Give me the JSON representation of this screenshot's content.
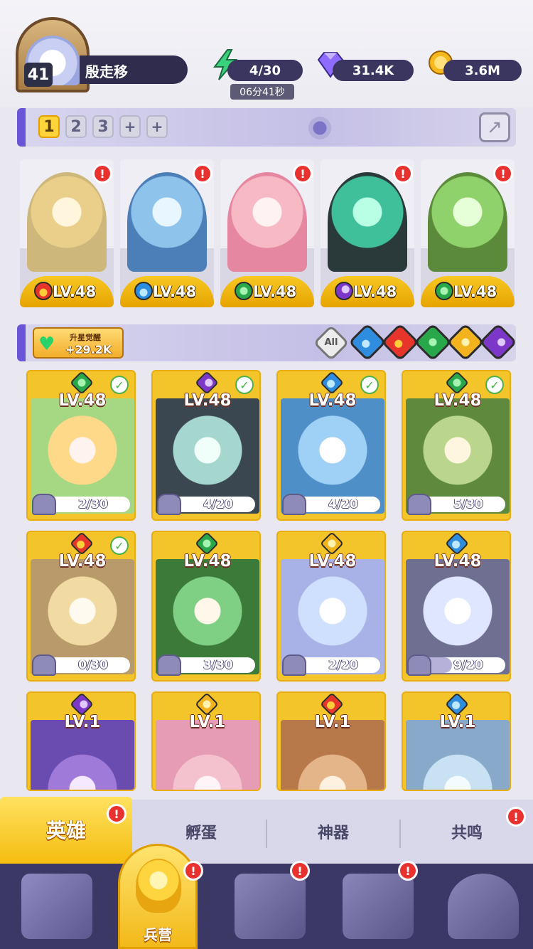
{
  "player": {
    "level": "41",
    "name": "殷走移",
    "avatar_icon": "ghost-avatar-icon"
  },
  "resources": {
    "stamina": {
      "value": "4/30",
      "timer": "06分41秒",
      "icon": "lightning-icon",
      "color": "#39d17c"
    },
    "gems": {
      "value": "31.4K",
      "icon": "diamond-icon",
      "color": "#7c5cff"
    },
    "gold": {
      "value": "3.6M",
      "icon": "coin-icon",
      "color": "#f5b81d"
    }
  },
  "team_bar": {
    "slots": [
      "1",
      "2",
      "3",
      "+",
      "+"
    ],
    "active_slot": "1"
  },
  "team": [
    {
      "level": "LV.48",
      "element": "fire",
      "alert": "!"
    },
    {
      "level": "LV.48",
      "element": "water",
      "alert": "!"
    },
    {
      "level": "LV.48",
      "element": "wind",
      "alert": "!"
    },
    {
      "level": "LV.48",
      "element": "dark",
      "alert": "!"
    },
    {
      "level": "LV.48",
      "element": "wind",
      "alert": "!"
    }
  ],
  "filter_bar": {
    "power_label": "升星觉醒",
    "power_value": "+29.2K",
    "all_label": "All",
    "elements": [
      "water",
      "fire",
      "wind",
      "light",
      "dark"
    ]
  },
  "heroes": [
    {
      "level": "LV.48",
      "element": "wind",
      "progress": "2/30",
      "progress_fraction": 0.067,
      "checked": true
    },
    {
      "level": "LV.48",
      "element": "dark",
      "progress": "4/20",
      "progress_fraction": 0.2,
      "checked": true
    },
    {
      "level": "LV.48",
      "element": "water",
      "progress": "4/20",
      "progress_fraction": 0.2,
      "checked": true
    },
    {
      "level": "LV.48",
      "element": "wind",
      "progress": "5/30",
      "progress_fraction": 0.167,
      "checked": true
    },
    {
      "level": "LV.48",
      "element": "fire",
      "progress": "0/30",
      "progress_fraction": 0.0,
      "checked": true
    },
    {
      "level": "LV.48",
      "element": "wind",
      "progress": "3/30",
      "progress_fraction": 0.1,
      "checked": false
    },
    {
      "level": "LV.48",
      "element": "light",
      "progress": "2/20",
      "progress_fraction": 0.1,
      "checked": false
    },
    {
      "level": "LV.48",
      "element": "water",
      "progress": "9/20",
      "progress_fraction": 0.45,
      "checked": false
    },
    {
      "level": "LV.1",
      "element": "dark"
    },
    {
      "level": "LV.1",
      "element": "light"
    },
    {
      "level": "LV.1",
      "element": "fire"
    },
    {
      "level": "LV.1",
      "element": "water"
    }
  ],
  "tabs": {
    "heroes": "英雄",
    "hatch": "孵蛋",
    "artifacts": "神器",
    "resonance": "共鸣",
    "alert": "!"
  },
  "bottom_nav": {
    "barracks_label": "兵营",
    "alert": "!",
    "items": [
      "cards-icon",
      "barracks-icon",
      "map-icon",
      "castle-icon",
      "mushroom-icon"
    ]
  }
}
